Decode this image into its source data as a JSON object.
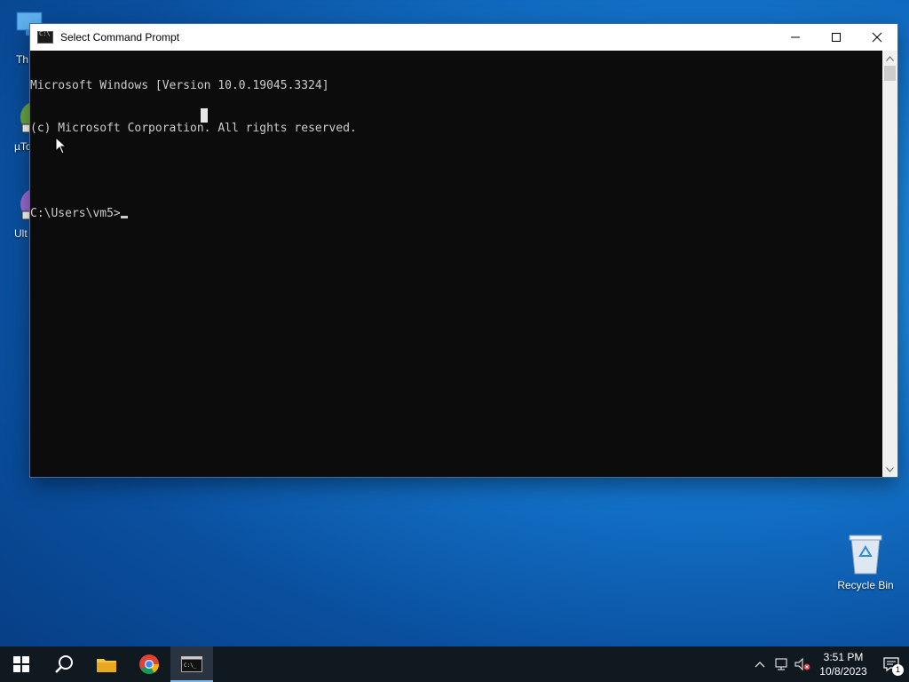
{
  "desktop": {
    "icons": [
      {
        "label": "Th"
      },
      {
        "label": "µTo"
      },
      {
        "label": "Ult"
      }
    ],
    "recycle_bin": {
      "label": "Recycle Bin"
    }
  },
  "window": {
    "title": "Select Command Prompt",
    "minimize": "—",
    "maximize": "☐",
    "close": "✕",
    "console_lines": [
      "Microsoft Windows [Version 10.0.19045.3324]",
      "(c) Microsoft Corporation. All rights reserved.",
      "",
      "C:\\Users\\vm5>"
    ]
  },
  "taskbar": {
    "icons": [
      "windows-start-icon",
      "search-icon",
      "file-explorer-icon",
      "chrome-icon",
      "command-prompt-icon"
    ],
    "time": "3:51 PM",
    "date": "10/8/2023",
    "notification_count": "1"
  },
  "colors": {
    "console_bg": "#0c0c0c",
    "console_text": "#cccccc",
    "taskbar_bg": "#101820",
    "accent": "#76b9ed"
  }
}
